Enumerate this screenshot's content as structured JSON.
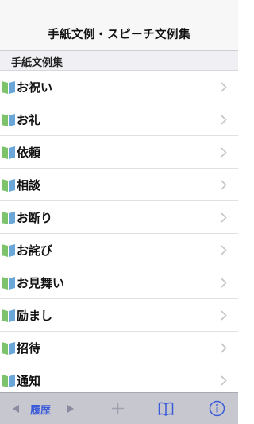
{
  "nav": {
    "title": "手紙文例・スピーチ文例集"
  },
  "section": {
    "title": "手紙文例集"
  },
  "items": [
    {
      "label": "お祝い"
    },
    {
      "label": "お礼"
    },
    {
      "label": "依頼"
    },
    {
      "label": "相談"
    },
    {
      "label": "お断り"
    },
    {
      "label": "お詫び"
    },
    {
      "label": "お見舞い"
    },
    {
      "label": "励まし"
    },
    {
      "label": "招待"
    },
    {
      "label": "通知"
    }
  ],
  "toolbar": {
    "back_icon": "triangle-left-icon",
    "history_label": "履歴",
    "forward_icon": "triangle-right-icon",
    "add_icon": "plus-icon",
    "bookmarks_icon": "book-icon",
    "info_icon": "info-icon"
  },
  "colors": {
    "accent": "#3a5bd9",
    "toolbar_bg": "#c7c7cf",
    "book_green": "#7cc36b",
    "book_blue": "#6aa7d8"
  }
}
